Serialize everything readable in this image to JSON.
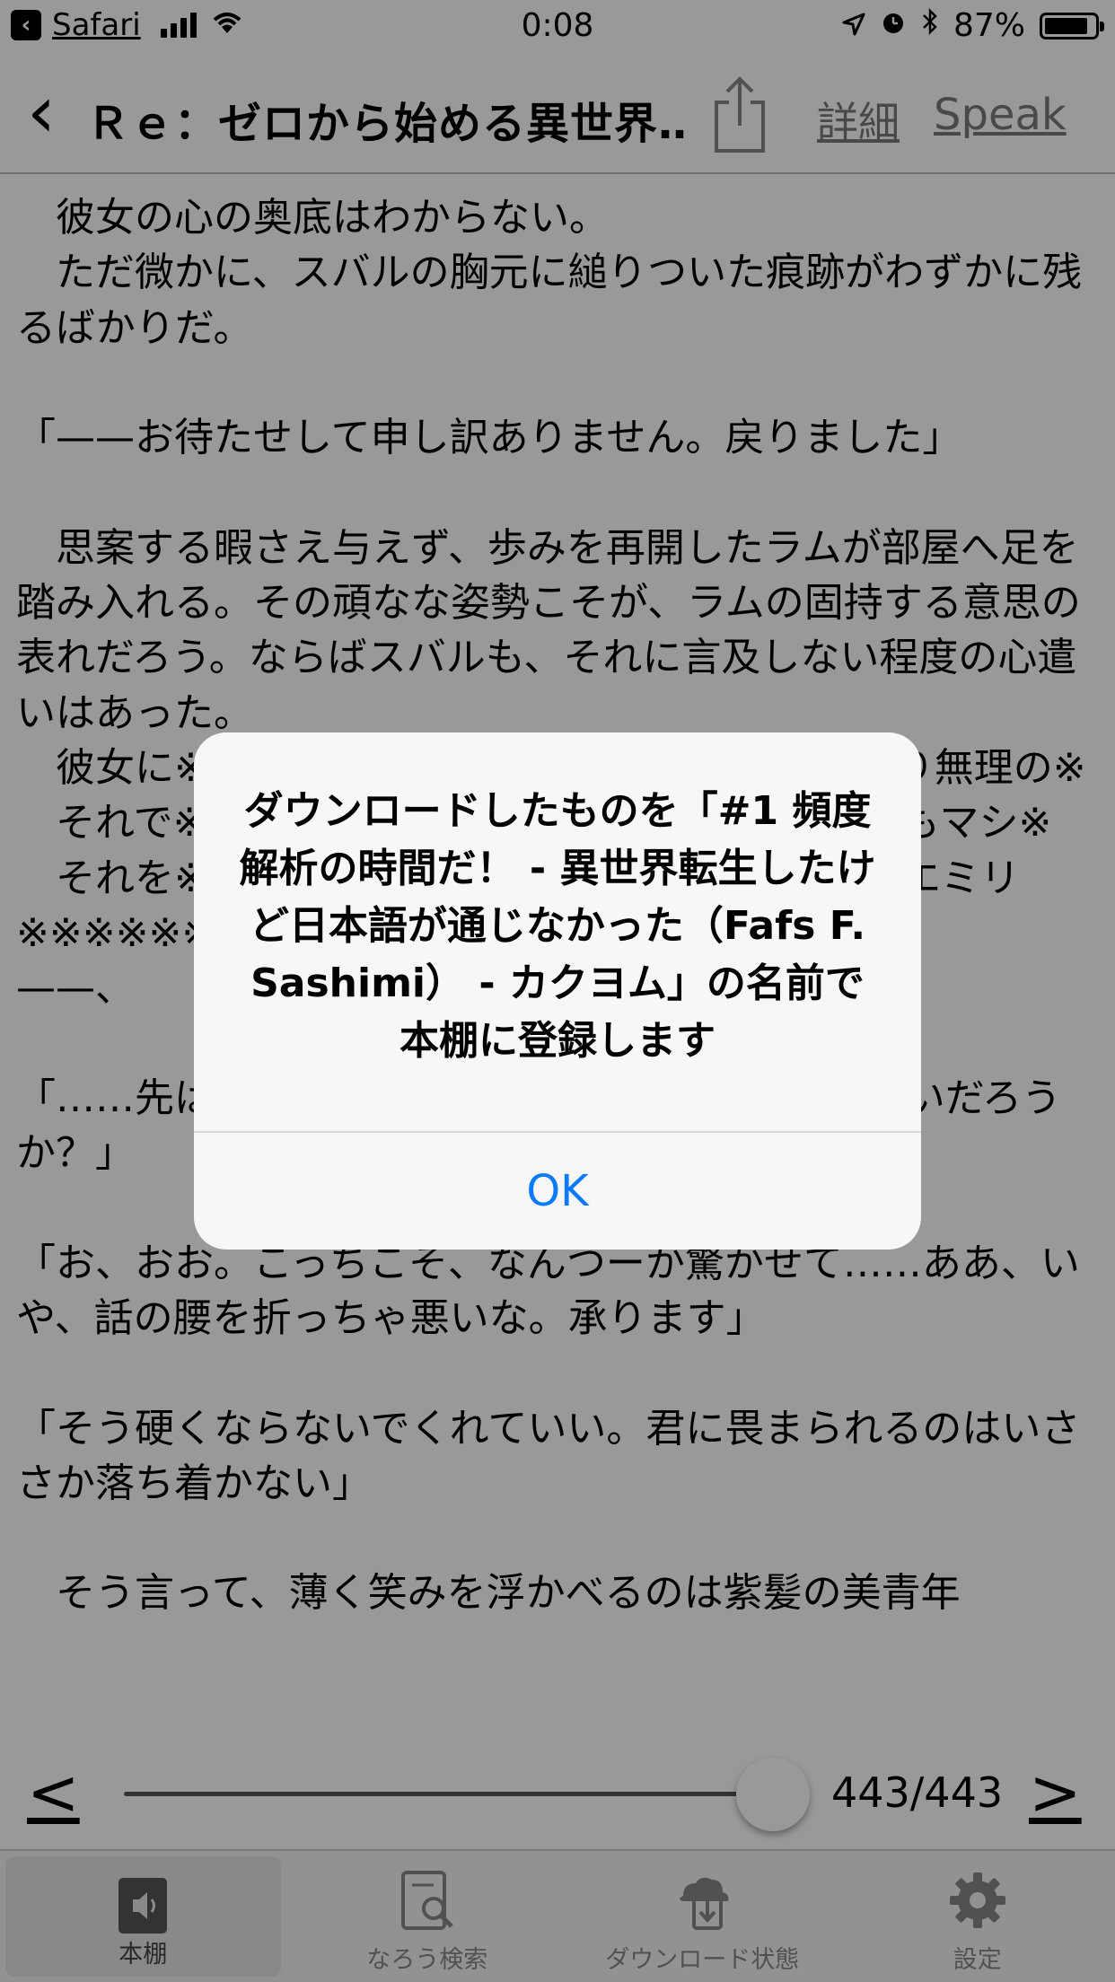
{
  "status_bar": {
    "back_app": "Safari",
    "time": "0:08",
    "battery": "87%",
    "battery_level": 0.87
  },
  "nav": {
    "title": "Ｒｅ：ゼロから始める異世界…",
    "details_label": "詳細",
    "speak_label": "Speak"
  },
  "reader": {
    "text": "　彼女の心の奥底はわからない。\n　ただ微かに、スバルの胸元に縋りついた痕跡がわずかに残るばかりだ。\n\n「——お待たせして申し訳ありません。戻りました」\n\n　思案する暇さえ与えず、歩みを再開したラムが部屋へ足を踏み入れる。その頑なな姿勢こそが、ラムの固持する意思の表れだろう。ならばスバルも、それに言及しない程度の心遣いはあった。\n　彼女に※※※※※※※※※※※※※※※※※は多少なり無理の※\n　それで※※※※※※※※※※※※※※※※べれば幾分もマシ※\n　それを※※※※※※※※※※※※※※※※苦労様」とエミリ※※※※※※※※※※※※※※※※のは\n——、\n\n「……先は※※※※※※※※※※※※※※※改めて、いいだろうか？」\n\n「お、おお。こっちこそ、なんつーか驚かせて……ああ、いや、話の腰を折っちゃ悪いな。承ります」\n\n「そう硬くならないでくれていい。君に畏まられるのはいささか落ち着かない」\n\n　そう言って、薄く笑みを浮かべるのは紫髪の美青年"
  },
  "pager": {
    "prev_label": "<",
    "next_label": ">",
    "page_count": "443/443",
    "current_page": 443,
    "total_pages": 443
  },
  "tabs": [
    {
      "label": "本棚",
      "icon": "bookshelf-icon",
      "active": true
    },
    {
      "label": "なろう検索",
      "icon": "search-book-icon",
      "active": false
    },
    {
      "label": "ダウンロード状態",
      "icon": "cloud-download-icon",
      "active": false
    },
    {
      "label": "設定",
      "icon": "gear-icon",
      "active": false
    }
  ],
  "alert": {
    "message": "ダウンロードしたものを「#1 頻度解析の時間だ！ - 異世界転生したけど日本語が通じなかった（Fafs F. Sashimi） - カクヨム」の名前で本棚に登録します",
    "ok_label": "OK"
  },
  "colors": {
    "accent": "#0a7aff",
    "link_gray": "#7a7a7a",
    "overlay": "rgba(0,0,0,0.4)"
  }
}
